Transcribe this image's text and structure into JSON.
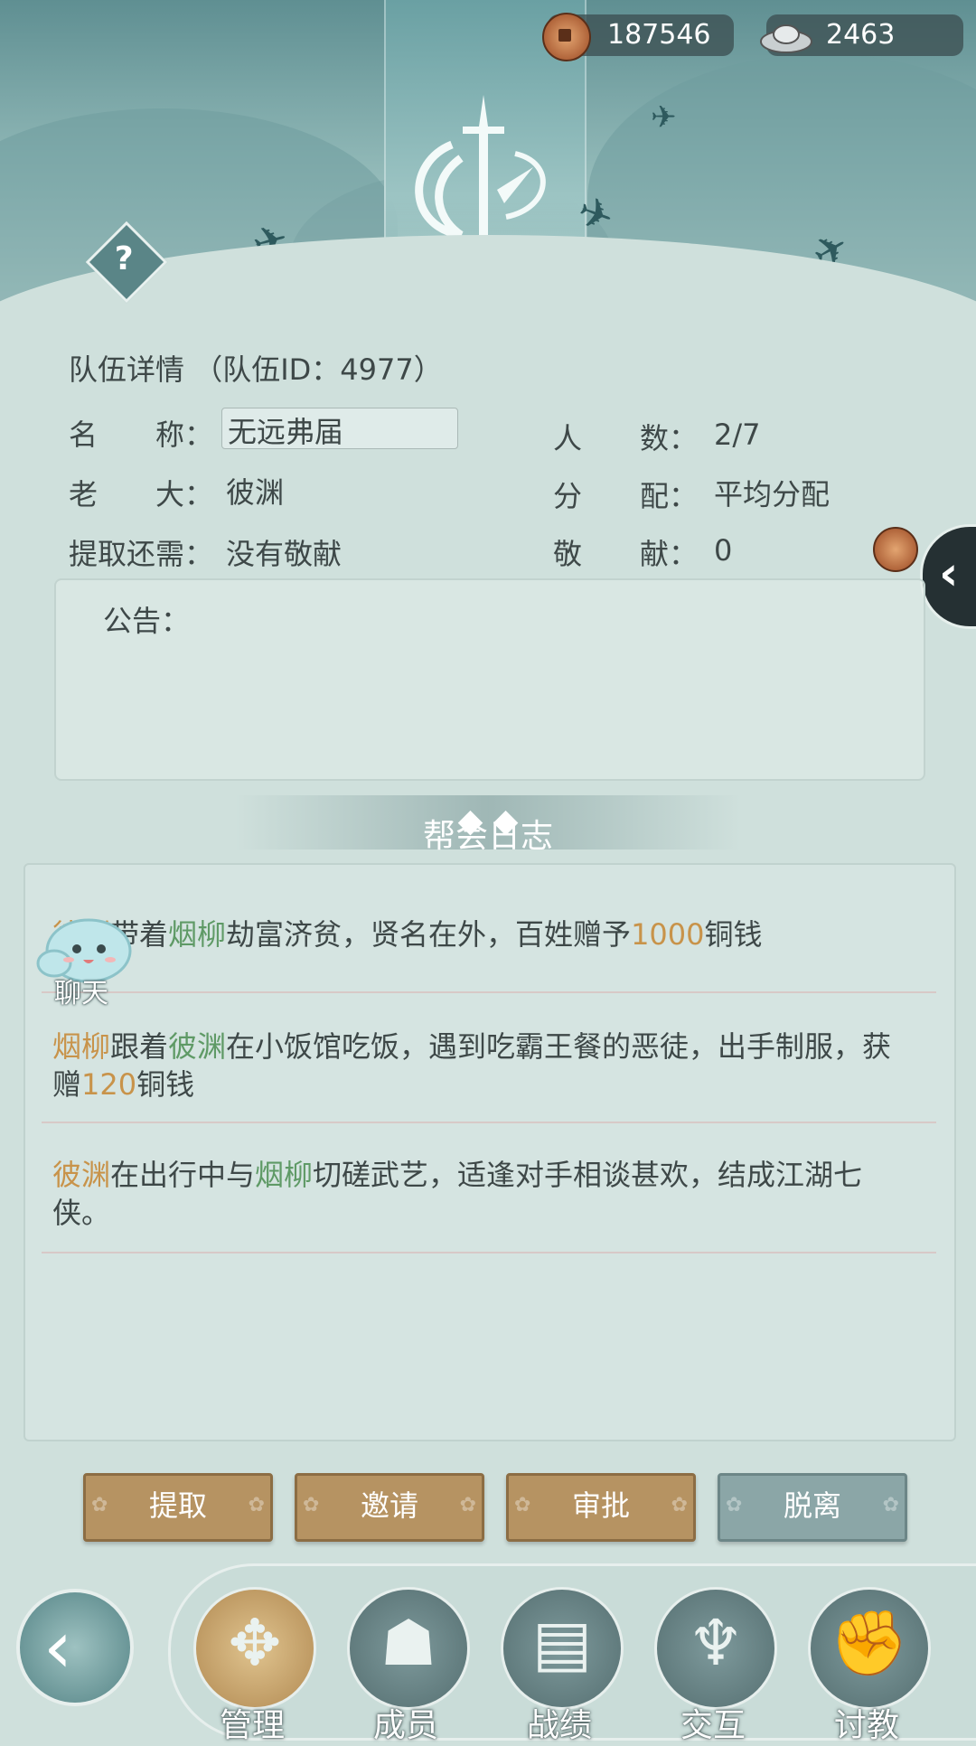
{
  "currency": {
    "copper": "187546",
    "silver": "2463"
  },
  "team": {
    "title": "队伍详情",
    "id_label": "（队伍ID：4977）",
    "name_label": "名　　称：",
    "name_value": "无远弗届",
    "boss_label": "老　　大：",
    "boss_value": "彼渊",
    "withdraw_label": "提取还需：",
    "withdraw_value": "没有敬献",
    "count_label": "人　　数：",
    "count_value": "2/7",
    "distribution_label": "分　　配：",
    "distribution_value": "平均分配",
    "contribution_label": "敬　　献：",
    "contribution_value": "0"
  },
  "notice": {
    "label": "公告："
  },
  "log": {
    "title": "帮会日志",
    "entries": [
      {
        "a": "彼渊",
        "t1": "带着",
        "b": "烟柳",
        "t2": "劫富济贫，贤名在外，百姓赠予",
        "n": "1000",
        "t3": "铜钱"
      },
      {
        "a": "烟柳",
        "t1": "跟着",
        "b": "彼渊",
        "t2": "在小饭馆吃饭，遇到吃霸王餐的恶徒，出手制服，获赠",
        "n": "120",
        "t3": "铜钱"
      },
      {
        "a": "彼渊",
        "t1": "在出行中与",
        "b": "烟柳",
        "t2": "切磋武艺，适逢对手相谈甚欢，结成江湖七侠。"
      }
    ]
  },
  "chat": {
    "label": "聊天"
  },
  "buttons": {
    "withdraw": "提取",
    "invite": "邀请",
    "approve": "审批",
    "leave": "脱离"
  },
  "nav": {
    "manage": "管理",
    "members": "成员",
    "record": "战绩",
    "interact": "交互",
    "teach": "讨教"
  },
  "colors": {
    "name_gold": "#c8934a",
    "name_green": "#5f9a66",
    "button_gold": "#b69362",
    "button_grey": "#8ba6a7"
  },
  "icons": {
    "help": "question-icon",
    "copper": "copper-coin-icon",
    "silver": "silver-ingot-icon"
  }
}
